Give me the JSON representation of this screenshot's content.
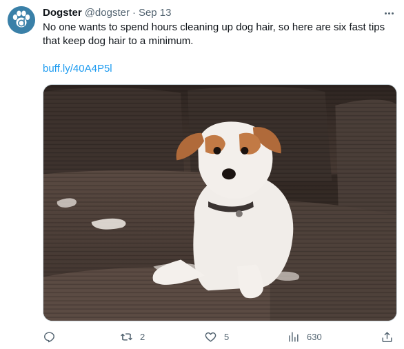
{
  "tweet": {
    "author_name": "Dogster",
    "handle": "@dogster",
    "separator": "·",
    "date": "Sep 13",
    "text": "No one wants to spend hours cleaning up dog hair, so here are six fast tips that keep dog hair to a minimum.",
    "link_text": "buff.ly/40A4P5l"
  },
  "avatar": {
    "icon": "paw-icon",
    "color": "#3a80a8"
  },
  "media": {
    "description_icon": "dog-on-couch-photo"
  },
  "actions": {
    "reply": {
      "icon": "reply-icon"
    },
    "retweet": {
      "icon": "retweet-icon",
      "count": "2"
    },
    "like": {
      "icon": "heart-icon",
      "count": "5"
    },
    "views": {
      "icon": "views-icon",
      "count": "630"
    },
    "share": {
      "icon": "share-icon"
    }
  },
  "colors": {
    "link": "#1d9bf0",
    "secondary_text": "#536471"
  }
}
